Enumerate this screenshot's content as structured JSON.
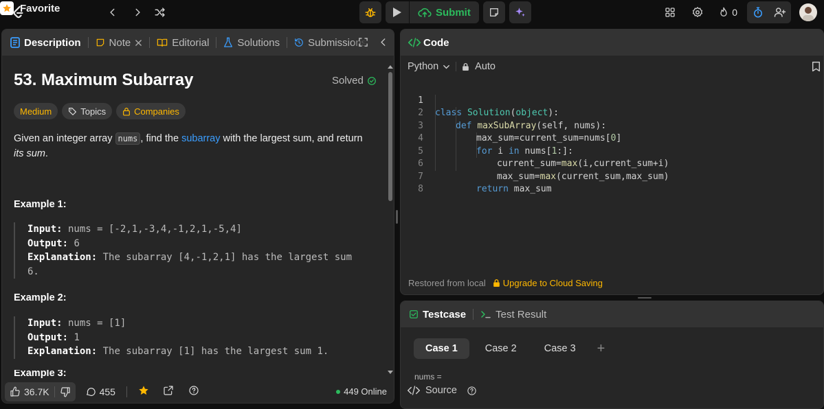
{
  "topbar": {
    "favorite_label": "Favorite",
    "submit_label": "Submit",
    "streak_count": "0"
  },
  "left_tabs": [
    {
      "label": "Description"
    },
    {
      "label": "Note"
    },
    {
      "label": "Editorial"
    },
    {
      "label": "Solutions"
    },
    {
      "label": "Submissions"
    }
  ],
  "problem": {
    "title": "53. Maximum Subarray",
    "status": "Solved",
    "difficulty": "Medium",
    "topics_label": "Topics",
    "companies_label": "Companies",
    "desc_before": "Given an integer array ",
    "desc_code": "nums",
    "desc_mid": ", find the ",
    "desc_link": "subarray",
    "desc_after": " with the largest sum, and return ",
    "desc_em": "its sum",
    "desc_end": "."
  },
  "examples": [
    {
      "title": "Example 1:",
      "input_label": "Input:",
      "input": " nums = [-2,1,-3,4,-1,2,1,-5,4]",
      "output_label": "Output:",
      "output": " 6",
      "explanation_label": "Explanation:",
      "explanation": " The subarray [4,-1,2,1] has the largest sum",
      "explanation_cont": "6."
    },
    {
      "title": "Example 2:",
      "input_label": "Input:",
      "input": " nums = [1]",
      "output_label": "Output:",
      "output": " 1",
      "explanation_label": "Explanation:",
      "explanation": " The subarray [1] has the largest sum 1."
    },
    {
      "title": "Example 3:"
    }
  ],
  "footer": {
    "likes": "36.7K",
    "comments": "455",
    "online": "449 Online"
  },
  "code_panel": {
    "title": "Code",
    "language": "Python",
    "mode": "Auto",
    "line_numbers": [
      "1",
      "2",
      "3",
      "4",
      "5",
      "6",
      "7",
      "8"
    ],
    "restored": "Restored from local",
    "upgrade": "Upgrade to Cloud Saving"
  },
  "code": {
    "l1_class": "class",
    "l1_name": "Solution",
    "l1_open": "(",
    "l1_base": "object",
    "l1_close": "):",
    "l2_def": "def",
    "l2_fn": "maxSubArray",
    "l2_args": "(self, nums):",
    "l3": "max_sum=current_sum=nums[",
    "l3_num": "0",
    "l3_end": "]",
    "l4_for": "for",
    "l4_i": " i ",
    "l4_in": "in",
    "l4_rest": " nums[",
    "l4_num": "1",
    "l4_end": ":]:",
    "l5_a": "current_sum=",
    "l5_fn": "max",
    "l5_b": "(i,current_sum+i)",
    "l6_a": "max_sum=",
    "l6_fn": "max",
    "l6_b": "(current_sum,max_sum)",
    "l7_ret": "return",
    "l7_b": " max_sum"
  },
  "test_panel": {
    "tab_testcase": "Testcase",
    "tab_result": "Test Result",
    "cases": [
      "Case 1",
      "Case 2",
      "Case 3"
    ],
    "add_case": "+",
    "param_label": "nums =",
    "source_label": "Source"
  },
  "colors": {
    "accent_green": "#2cbb5d",
    "accent_yellow": "#ffb800",
    "link_blue": "#3b9eff"
  }
}
